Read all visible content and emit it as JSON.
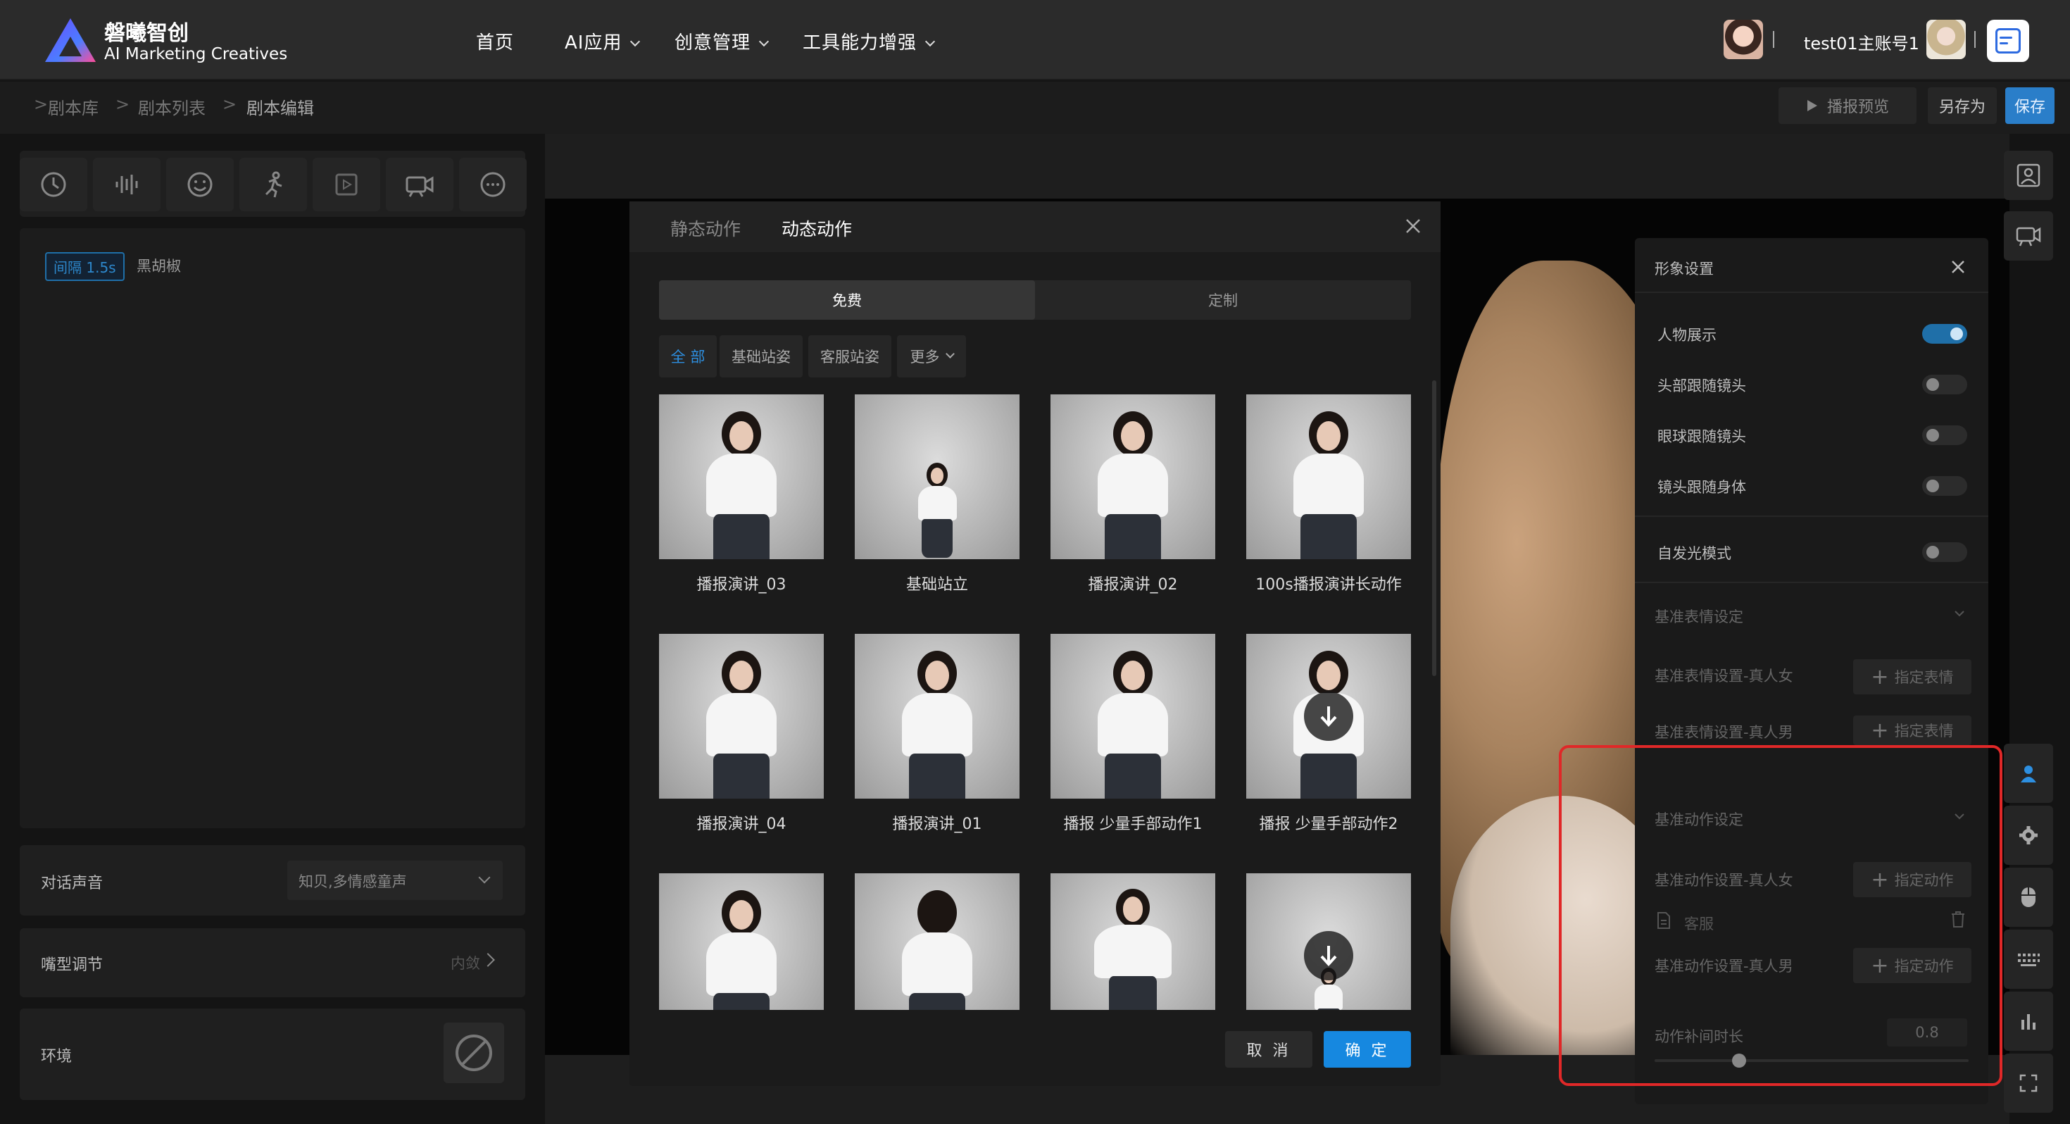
{
  "header": {
    "brand_cn": "磐曦智创",
    "brand_en": "AI Marketing Creatives",
    "nav": [
      {
        "label": "首页",
        "has_dropdown": false
      },
      {
        "label": "AI应用",
        "has_dropdown": true
      },
      {
        "label": "创意管理",
        "has_dropdown": true
      },
      {
        "label": "工具能力增强",
        "has_dropdown": true
      }
    ],
    "username": "test01主账号1"
  },
  "breadcrumb": {
    "items": [
      "剧本库",
      "剧本列表",
      "剧本编辑"
    ],
    "separator": ">"
  },
  "actions": {
    "preview": "播报预览",
    "save_as": "另存为",
    "save": "保存"
  },
  "left_panel": {
    "toolbar_icons": [
      "clock-icon",
      "audio-wave-icon",
      "smile-icon",
      "running-person-icon",
      "video-play-icon",
      "camera-icon",
      "more-icon"
    ],
    "script": {
      "gap_tag": "间隔 1.5s",
      "text": "黑胡椒"
    },
    "voice": {
      "label": "对话声音",
      "value": "知贝,多情感童声"
    },
    "mouth": {
      "label": "嘴型调节",
      "value": "内敛"
    },
    "environment": {
      "label": "环境"
    }
  },
  "modal": {
    "tabs": [
      {
        "label": "静态动作",
        "active": false
      },
      {
        "label": "动态动作",
        "active": true
      }
    ],
    "segment": [
      {
        "label": "免费",
        "active": true
      },
      {
        "label": "定制",
        "active": false
      }
    ],
    "filters": [
      {
        "label": "全 部",
        "active": true
      },
      {
        "label": "基础站姿",
        "active": false
      },
      {
        "label": "客服站姿",
        "active": false
      },
      {
        "label": "更多",
        "active": false
      }
    ],
    "items": [
      {
        "label": "播报演讲_03",
        "download": false
      },
      {
        "label": "基础站立",
        "download": false
      },
      {
        "label": "播报演讲_02",
        "download": false
      },
      {
        "label": "100s播报演讲长动作",
        "download": false
      },
      {
        "label": "播报演讲_04",
        "download": false
      },
      {
        "label": "播报演讲_01",
        "download": false
      },
      {
        "label": "播报 少量手部动作1",
        "download": false
      },
      {
        "label": "播报 少量手部动作2",
        "download": true
      },
      {
        "label": "",
        "download": false
      },
      {
        "label": "",
        "download": false
      },
      {
        "label": "",
        "download": false
      },
      {
        "label": "",
        "download": true
      }
    ],
    "cancel": "取 消",
    "confirm": "确 定"
  },
  "settings": {
    "title": "形象设置",
    "toggles": [
      {
        "label": "人物展示",
        "on": true
      },
      {
        "label": "头部跟随镜头",
        "on": false
      },
      {
        "label": "眼球跟随镜头",
        "on": false
      },
      {
        "label": "镜头跟随身体",
        "on": false
      }
    ],
    "glow": {
      "label": "自发光模式",
      "on": false
    },
    "expression_section": "基准表情设定",
    "expression_female": "基准表情设置-真人女",
    "expression_male": "基准表情设置-真人男",
    "assign_expression": "指定表情",
    "action_section": "基准动作设定",
    "action_female": "基准动作设置-真人女",
    "action_female_value": "客服",
    "action_male": "基准动作设置-真人男",
    "assign_action": "指定动作",
    "interp_label": "动作补间时长",
    "interp_value": "0.8",
    "interp_fraction": 0.27
  },
  "right_icons": [
    "portrait-icon",
    "camera-icon",
    "person-icon",
    "gear-icon",
    "mouse-icon",
    "keyboard-icon",
    "bar-chart-icon",
    "fullscreen-icon"
  ]
}
